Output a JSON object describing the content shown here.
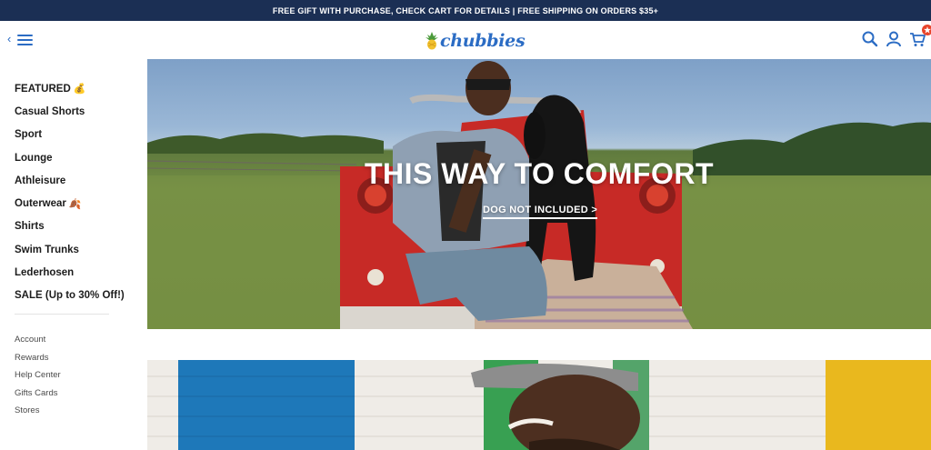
{
  "promo_bar": {
    "text": "FREE GIFT WITH PURCHASE, CHECK CART FOR DETAILS | FREE SHIPPING ON ORDERS $35+"
  },
  "header": {
    "logo_text": "chubbies",
    "menu_toggle": {
      "back_glyph": "‹",
      "icon": "hamburger-icon"
    },
    "icons": [
      "search-icon",
      "account-icon",
      "cart-icon"
    ]
  },
  "sidebar": {
    "nav_items": [
      {
        "label": "FEATURED",
        "emoji": "💰"
      },
      {
        "label": "Casual Shorts"
      },
      {
        "label": "Sport"
      },
      {
        "label": "Lounge"
      },
      {
        "label": "Athleisure"
      },
      {
        "label": "Outerwear",
        "emoji": "🍂"
      },
      {
        "label": "Shirts"
      },
      {
        "label": "Swim Trunks"
      },
      {
        "label": "Lederhosen"
      },
      {
        "label": "SALE (Up to 30% Off!)"
      }
    ],
    "secondary_items": [
      {
        "label": "Account"
      },
      {
        "label": "Rewards"
      },
      {
        "label": "Help Center"
      },
      {
        "label": "Gifts Cards"
      },
      {
        "label": "Stores"
      }
    ]
  },
  "hero": {
    "title": "THIS WAY TO COMFORT",
    "cta": "DOG NOT INCLUDED >"
  },
  "colors": {
    "promo_bg": "#1b2f54",
    "brand_blue": "#2b6cc4",
    "cart_badge": "#e8442a",
    "jeep_red": "#c72a26"
  }
}
